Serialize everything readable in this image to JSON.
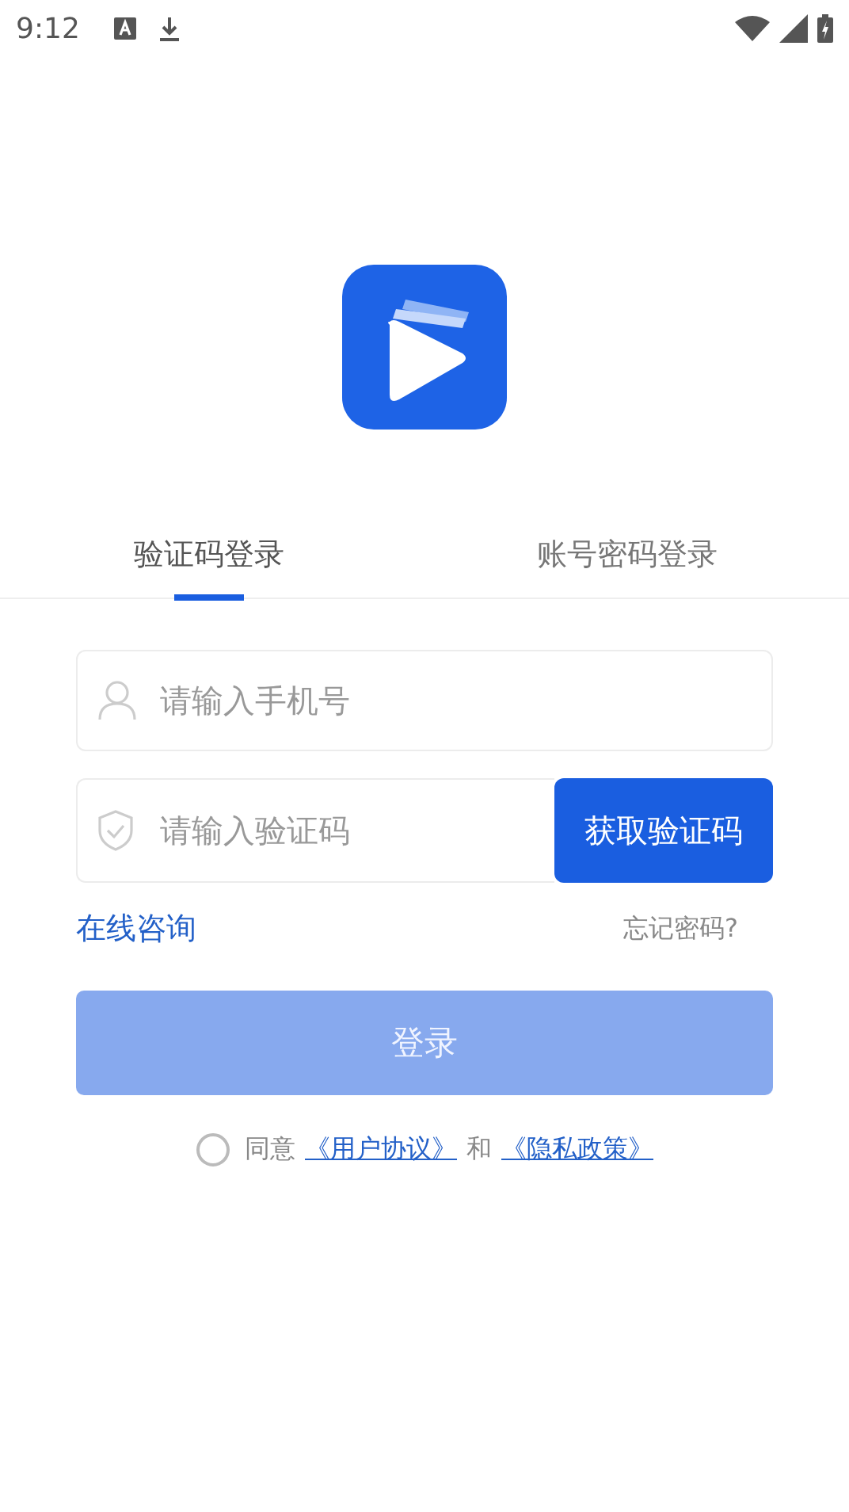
{
  "status_bar": {
    "time": "9:12"
  },
  "tabs": [
    {
      "label": "验证码登录",
      "selected": true
    },
    {
      "label": "账号密码登录",
      "selected": false
    }
  ],
  "phone_field": {
    "placeholder": "请输入手机号"
  },
  "code_field": {
    "placeholder": "请输入验证码"
  },
  "get_code_button": "获取验证码",
  "online_consult_link": "在线咨询",
  "forgot_password_link": "忘记密码?",
  "login_button": {
    "label": "登录",
    "disabled": true
  },
  "agreement": {
    "checked": false,
    "prefix": "同意",
    "user_agreement": "《用户协议》",
    "conjunction": "和",
    "privacy_policy": "《隐私政策》"
  }
}
